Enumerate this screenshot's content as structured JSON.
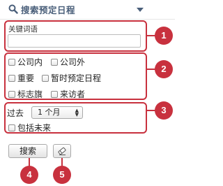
{
  "header": {
    "title": "搜索预定日程",
    "search_icon": "search-icon",
    "expand_icon": "triangle-down-icon"
  },
  "keyword": {
    "label": "关键词语",
    "value": ""
  },
  "filters": {
    "items": [
      {
        "label": "公司内",
        "checked": false
      },
      {
        "label": "公司外",
        "checked": false
      },
      {
        "label": "重要",
        "checked": false
      },
      {
        "label": "暂时预定日程",
        "checked": false
      },
      {
        "label": "标志旗",
        "checked": false
      },
      {
        "label": "来访者",
        "checked": false
      }
    ]
  },
  "period": {
    "prefix": "过去",
    "selected": "1 个月",
    "include_future_label": "包括未来",
    "include_future_checked": false
  },
  "actions": {
    "search_label": "搜索",
    "clear_icon": "eraser-icon"
  },
  "callouts": [
    "1",
    "2",
    "3",
    "4",
    "5"
  ],
  "colors": {
    "accent": "#c8313e",
    "title": "#4a5f7a"
  }
}
